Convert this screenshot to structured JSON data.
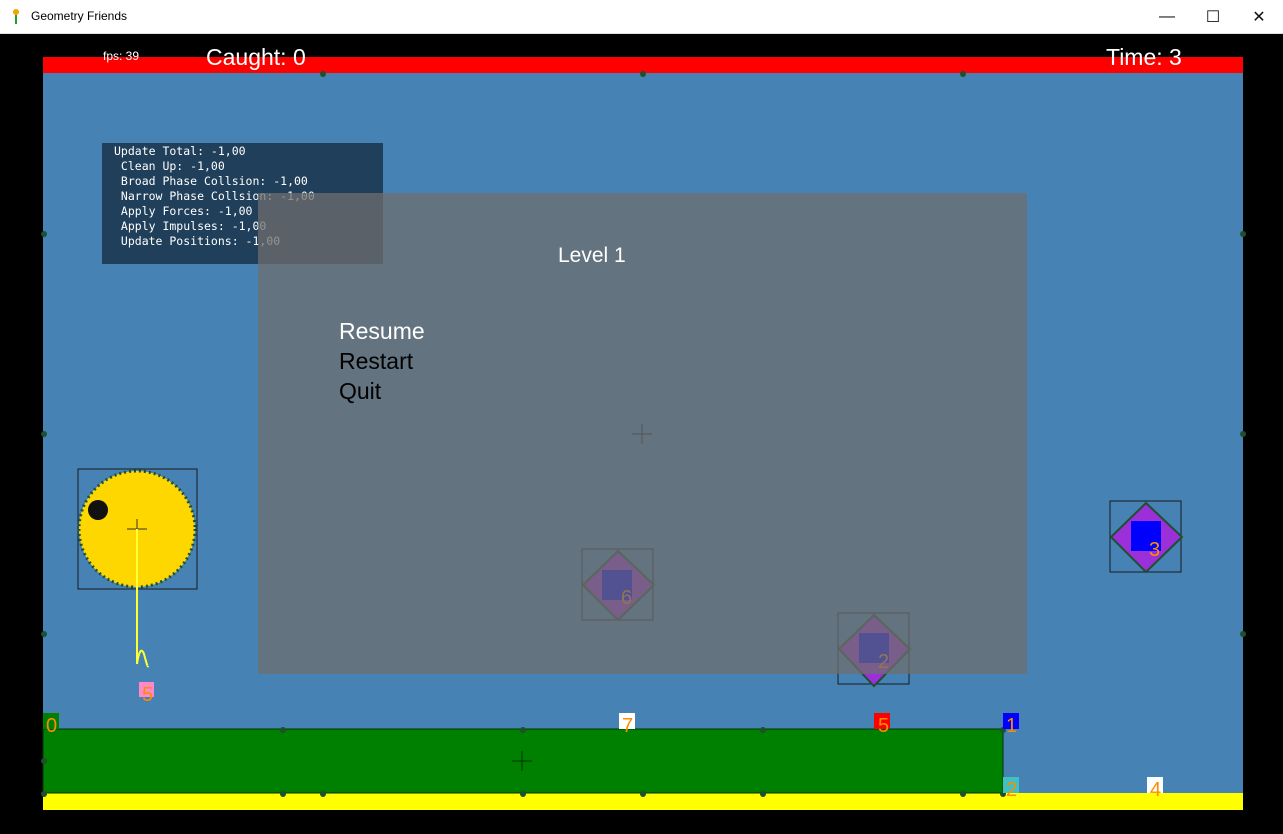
{
  "window": {
    "title": "Geometry Friends",
    "minimize": "—",
    "maximize": "☐",
    "close": "✕"
  },
  "hud": {
    "fps": "fps: 39",
    "caught": "Caught: 0",
    "time": "Time: 3"
  },
  "stats": [
    "Update Total: -1,00",
    " Clean Up: -1,00",
    " Broad Phase Collsion: -1,00",
    " Narrow Phase Collsion: -1,00",
    " Apply Forces: -1,00",
    " Apply Impulses: -1,00",
    " Update Positions: -1,00"
  ],
  "menu": {
    "level": "Level 1",
    "items": [
      "Resume",
      "Restart",
      "Quit"
    ]
  },
  "markers": [
    "0",
    "7",
    "5",
    "1",
    "2",
    "4",
    "6",
    "3",
    "2",
    "5"
  ],
  "colors": {
    "arena": "#4682b4",
    "top_bar": "#ff0000",
    "bottom_bar": "#ffff00",
    "platform": "#008000",
    "ball": "#ffd700",
    "collectible": "#9b30d9",
    "label": "#ff8c00"
  }
}
